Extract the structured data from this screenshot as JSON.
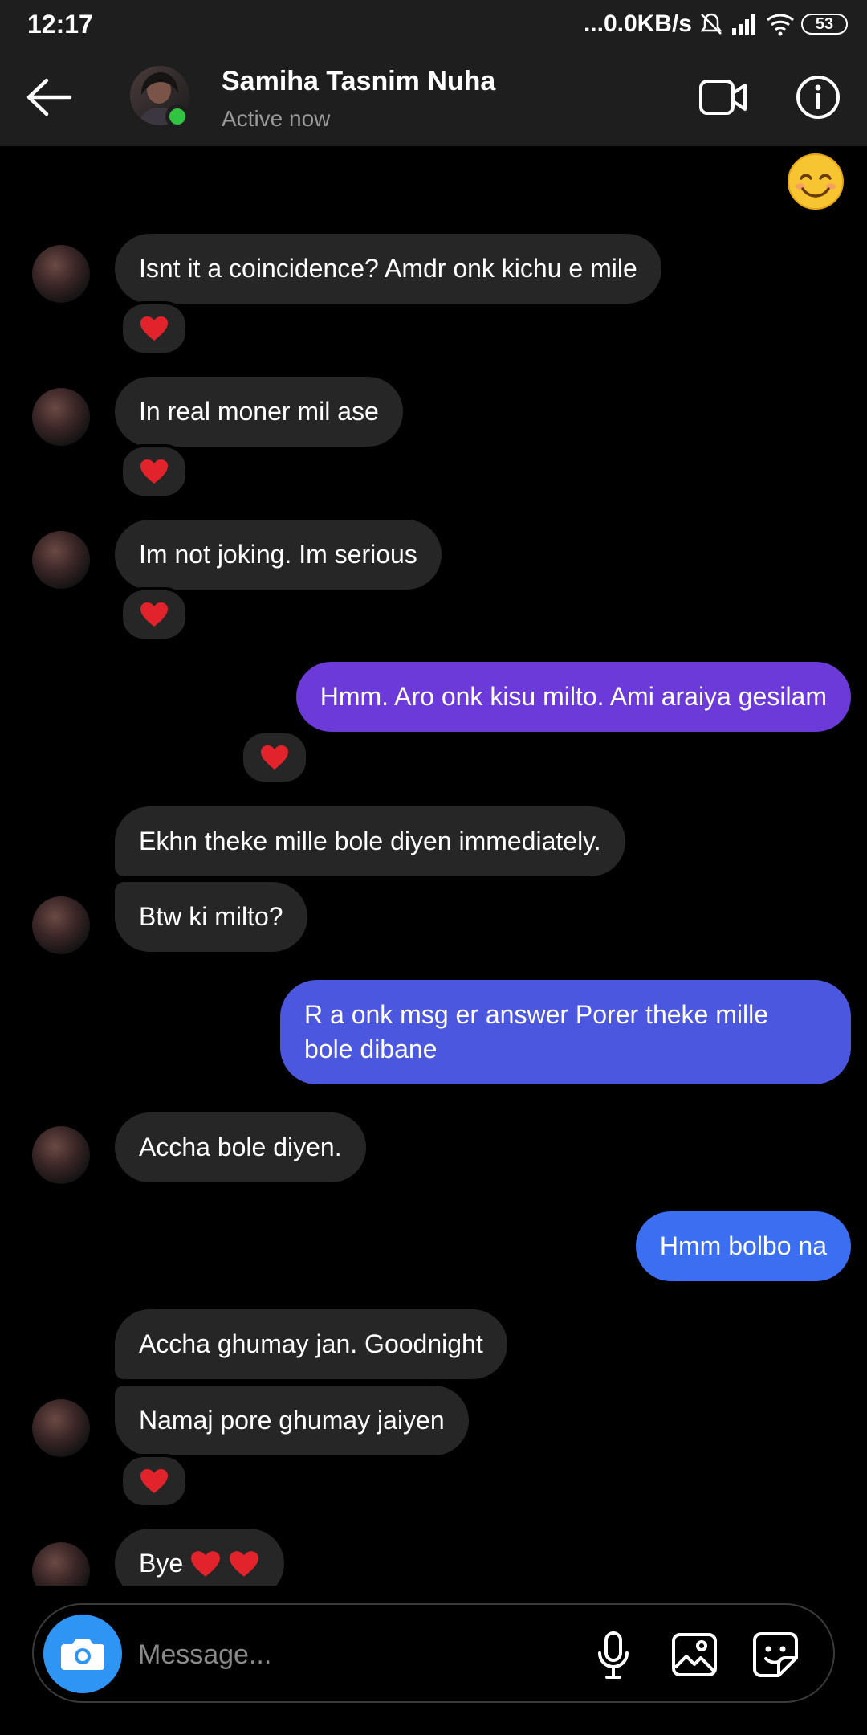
{
  "status": {
    "time": "12:17",
    "net": "...0.0KB/s",
    "battery": "53"
  },
  "header": {
    "name": "Samiha Tasnim Nuha",
    "presence": "Active now"
  },
  "messages": [
    {
      "text": "Isnt it a coincidence? Amdr onk kichu e mile",
      "reaction": "heart"
    },
    {
      "text": "In real moner mil ase",
      "reaction": "heart"
    },
    {
      "text": "Im not joking. Im serious",
      "reaction": "heart"
    },
    {
      "text": "Hmm. Aro onk kisu milto. Ami araiya gesilam",
      "reaction": "heart"
    },
    {
      "text": "Ekhn theke mille bole diyen immediately."
    },
    {
      "text": "Btw ki milto?"
    },
    {
      "line1": "R a onk msg er answer  Porer theke mille",
      "line2": "bole dibane"
    },
    {
      "text": "Accha bole diyen."
    },
    {
      "text": "Hmm bolbo na"
    },
    {
      "text": "Accha ghumay jan. Goodnight"
    },
    {
      "text": "Namaj pore ghumay jaiyen",
      "reaction": "heart"
    },
    {
      "text": "Bye"
    }
  ],
  "composer": {
    "placeholder": "Message..."
  },
  "colors": {
    "incoming": "#262626",
    "outgoing_purple": "#6c3ad8",
    "outgoing_indigo": "#4c57df",
    "outgoing_blue": "#3b6ef0",
    "online": "#31c443",
    "camera": "#2f95f4"
  },
  "icons": [
    "back-arrow-icon",
    "video-call-icon",
    "info-icon",
    "smiling-face-emoji",
    "heart-icon",
    "camera-icon",
    "microphone-icon",
    "gallery-icon",
    "sticker-icon"
  ]
}
